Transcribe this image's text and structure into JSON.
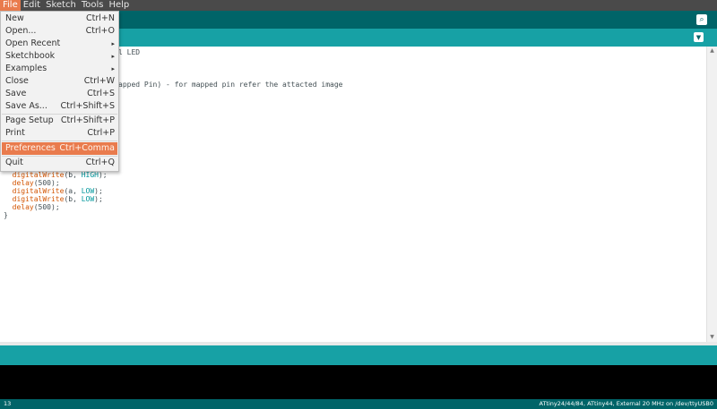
{
  "menubar": {
    "items": [
      "File",
      "Edit",
      "Sketch",
      "Tools",
      "Help"
    ]
  },
  "file_menu": {
    "items": [
      {
        "label": "New",
        "shortcut": "Ctrl+N"
      },
      {
        "label": "Open...",
        "shortcut": "Ctrl+O"
      },
      {
        "label": "Open Recent",
        "shortcut": "▸"
      },
      {
        "label": "Sketchbook",
        "shortcut": "▸"
      },
      {
        "label": "Examples",
        "shortcut": "▸"
      },
      {
        "label": "Close",
        "shortcut": "Ctrl+W"
      },
      {
        "label": "Save",
        "shortcut": "Ctrl+S"
      },
      {
        "label": "Save As...",
        "shortcut": "Ctrl+Shift+S"
      },
      {
        "label": "Page Setup",
        "shortcut": "Ctrl+Shift+P"
      },
      {
        "label": "Print",
        "shortcut": "Ctrl+P"
      },
      {
        "label": "Preferences",
        "shortcut": "Ctrl+Comma"
      },
      {
        "label": "Quit",
        "shortcut": "Ctrl+Q"
      }
    ]
  },
  "editor": {
    "visible_fragments": {
      "line1": "l LED",
      "line2": "apped Pin) - for mapped pin refer the attacted image"
    },
    "code": {
      "l1_fn": "digitalWrite",
      "l1_a": "(b, ",
      "l1_c": "HIGH",
      "l1_e": ");",
      "l2_fn": "delay",
      "l2_e": "(500);",
      "l3_fn": "digitalWrite",
      "l3_a": "(a, ",
      "l3_c": "LOW",
      "l3_e": ");",
      "l4_fn": "digitalWrite",
      "l4_a": "(b, ",
      "l4_c": "LOW",
      "l4_e": ");",
      "l5_fn": "delay",
      "l5_e": "(500);",
      "l6": "}"
    }
  },
  "status": {
    "line": "13",
    "board": "ATtiny24/44/84, ATtiny44, External 20 MHz on /dev/ttyUSB0"
  },
  "colors": {
    "accent": "#e97b4d",
    "toolbar": "#006468",
    "tabstrip": "#17a1a5"
  }
}
